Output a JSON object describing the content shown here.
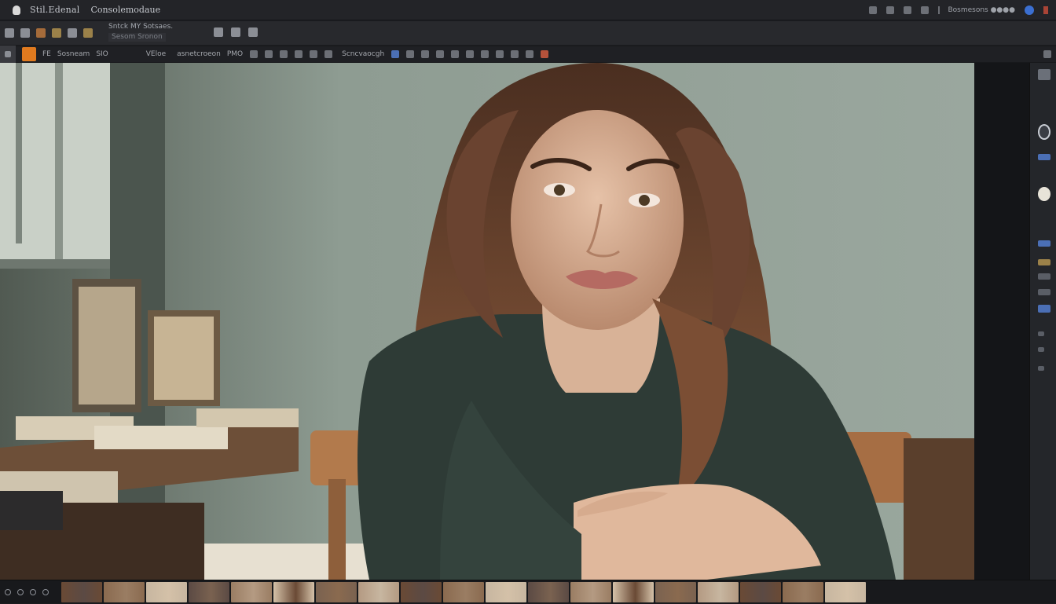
{
  "titlebar": {
    "title": "Stil.Edenal",
    "subtitle": "Consolemodaue",
    "status": "Bosmesons ●●●●"
  },
  "toolbar1": {
    "secondary_line1": "Sntck MY Sotsaes.",
    "secondary_line2": "Sesom Sronon"
  },
  "toolbar2": {
    "opt1": "FE",
    "opt2": "Sosneam",
    "opt3": "SIO",
    "opt4": "VEloe",
    "opt5": "asnetcroeon",
    "opt6": "PMO",
    "opt7": "Scncvaocgh"
  },
  "filmstrip": {
    "thumb_count": 19
  },
  "colors": {
    "accent": "#e07a1f",
    "panel_bg": "#24262a",
    "toolbar_bg": "#28292d"
  },
  "icons": [
    "app-icon",
    "window-icon",
    "link-icon",
    "settings-icon",
    "zoom-icon",
    "crop-tool-icon",
    "brush-icon"
  ]
}
